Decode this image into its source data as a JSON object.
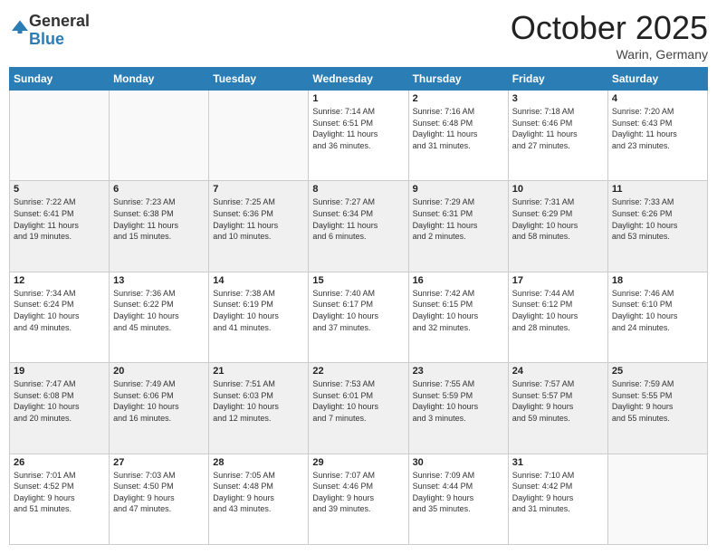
{
  "logo": {
    "general": "General",
    "blue": "Blue"
  },
  "header": {
    "month": "October 2025",
    "location": "Warin, Germany"
  },
  "weekdays": [
    "Sunday",
    "Monday",
    "Tuesday",
    "Wednesday",
    "Thursday",
    "Friday",
    "Saturday"
  ],
  "weeks": [
    [
      {
        "day": "",
        "info": ""
      },
      {
        "day": "",
        "info": ""
      },
      {
        "day": "",
        "info": ""
      },
      {
        "day": "1",
        "info": "Sunrise: 7:14 AM\nSunset: 6:51 PM\nDaylight: 11 hours\nand 36 minutes."
      },
      {
        "day": "2",
        "info": "Sunrise: 7:16 AM\nSunset: 6:48 PM\nDaylight: 11 hours\nand 31 minutes."
      },
      {
        "day": "3",
        "info": "Sunrise: 7:18 AM\nSunset: 6:46 PM\nDaylight: 11 hours\nand 27 minutes."
      },
      {
        "day": "4",
        "info": "Sunrise: 7:20 AM\nSunset: 6:43 PM\nDaylight: 11 hours\nand 23 minutes."
      }
    ],
    [
      {
        "day": "5",
        "info": "Sunrise: 7:22 AM\nSunset: 6:41 PM\nDaylight: 11 hours\nand 19 minutes."
      },
      {
        "day": "6",
        "info": "Sunrise: 7:23 AM\nSunset: 6:38 PM\nDaylight: 11 hours\nand 15 minutes."
      },
      {
        "day": "7",
        "info": "Sunrise: 7:25 AM\nSunset: 6:36 PM\nDaylight: 11 hours\nand 10 minutes."
      },
      {
        "day": "8",
        "info": "Sunrise: 7:27 AM\nSunset: 6:34 PM\nDaylight: 11 hours\nand 6 minutes."
      },
      {
        "day": "9",
        "info": "Sunrise: 7:29 AM\nSunset: 6:31 PM\nDaylight: 11 hours\nand 2 minutes."
      },
      {
        "day": "10",
        "info": "Sunrise: 7:31 AM\nSunset: 6:29 PM\nDaylight: 10 hours\nand 58 minutes."
      },
      {
        "day": "11",
        "info": "Sunrise: 7:33 AM\nSunset: 6:26 PM\nDaylight: 10 hours\nand 53 minutes."
      }
    ],
    [
      {
        "day": "12",
        "info": "Sunrise: 7:34 AM\nSunset: 6:24 PM\nDaylight: 10 hours\nand 49 minutes."
      },
      {
        "day": "13",
        "info": "Sunrise: 7:36 AM\nSunset: 6:22 PM\nDaylight: 10 hours\nand 45 minutes."
      },
      {
        "day": "14",
        "info": "Sunrise: 7:38 AM\nSunset: 6:19 PM\nDaylight: 10 hours\nand 41 minutes."
      },
      {
        "day": "15",
        "info": "Sunrise: 7:40 AM\nSunset: 6:17 PM\nDaylight: 10 hours\nand 37 minutes."
      },
      {
        "day": "16",
        "info": "Sunrise: 7:42 AM\nSunset: 6:15 PM\nDaylight: 10 hours\nand 32 minutes."
      },
      {
        "day": "17",
        "info": "Sunrise: 7:44 AM\nSunset: 6:12 PM\nDaylight: 10 hours\nand 28 minutes."
      },
      {
        "day": "18",
        "info": "Sunrise: 7:46 AM\nSunset: 6:10 PM\nDaylight: 10 hours\nand 24 minutes."
      }
    ],
    [
      {
        "day": "19",
        "info": "Sunrise: 7:47 AM\nSunset: 6:08 PM\nDaylight: 10 hours\nand 20 minutes."
      },
      {
        "day": "20",
        "info": "Sunrise: 7:49 AM\nSunset: 6:06 PM\nDaylight: 10 hours\nand 16 minutes."
      },
      {
        "day": "21",
        "info": "Sunrise: 7:51 AM\nSunset: 6:03 PM\nDaylight: 10 hours\nand 12 minutes."
      },
      {
        "day": "22",
        "info": "Sunrise: 7:53 AM\nSunset: 6:01 PM\nDaylight: 10 hours\nand 7 minutes."
      },
      {
        "day": "23",
        "info": "Sunrise: 7:55 AM\nSunset: 5:59 PM\nDaylight: 10 hours\nand 3 minutes."
      },
      {
        "day": "24",
        "info": "Sunrise: 7:57 AM\nSunset: 5:57 PM\nDaylight: 9 hours\nand 59 minutes."
      },
      {
        "day": "25",
        "info": "Sunrise: 7:59 AM\nSunset: 5:55 PM\nDaylight: 9 hours\nand 55 minutes."
      }
    ],
    [
      {
        "day": "26",
        "info": "Sunrise: 7:01 AM\nSunset: 4:52 PM\nDaylight: 9 hours\nand 51 minutes."
      },
      {
        "day": "27",
        "info": "Sunrise: 7:03 AM\nSunset: 4:50 PM\nDaylight: 9 hours\nand 47 minutes."
      },
      {
        "day": "28",
        "info": "Sunrise: 7:05 AM\nSunset: 4:48 PM\nDaylight: 9 hours\nand 43 minutes."
      },
      {
        "day": "29",
        "info": "Sunrise: 7:07 AM\nSunset: 4:46 PM\nDaylight: 9 hours\nand 39 minutes."
      },
      {
        "day": "30",
        "info": "Sunrise: 7:09 AM\nSunset: 4:44 PM\nDaylight: 9 hours\nand 35 minutes."
      },
      {
        "day": "31",
        "info": "Sunrise: 7:10 AM\nSunset: 4:42 PM\nDaylight: 9 hours\nand 31 minutes."
      },
      {
        "day": "",
        "info": ""
      }
    ]
  ]
}
